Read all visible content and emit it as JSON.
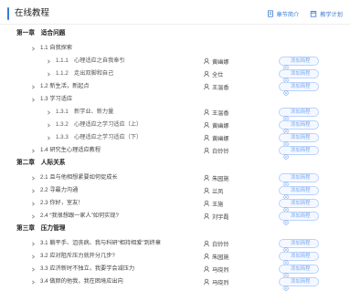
{
  "header": {
    "title": "在线教程",
    "links": [
      {
        "label": "章节简介",
        "icon": "document-icon"
      },
      {
        "label": "教学计划",
        "icon": "calendar-icon"
      }
    ]
  },
  "rows": [
    {
      "kind": "chapter",
      "label": "第一章　适合问题"
    },
    {
      "kind": "section",
      "label": "1.1 自我探索",
      "user": "",
      "button": ""
    },
    {
      "kind": "sub",
      "label": "1.1.1　心理适应之自我奉引",
      "user": "黄幽娜",
      "button": "添加简程"
    },
    {
      "kind": "sub",
      "label": "1.1.2　走出双脚和自己",
      "user": "全仕",
      "button": "添加简程"
    },
    {
      "kind": "section",
      "label": "1.2 新生活，新起点",
      "user": "王温香",
      "button": "添加简程"
    },
    {
      "kind": "section",
      "label": "1.3 学习适应",
      "user": "",
      "button": ""
    },
    {
      "kind": "sub",
      "label": "1.3.1　新学业、新力量",
      "user": "王温香",
      "button": "添加简程"
    },
    {
      "kind": "sub",
      "label": "1.3.2　心理适应之学习适应（上）",
      "user": "黄幽娜",
      "button": "添加简程"
    },
    {
      "kind": "sub",
      "label": "1.3.3　心理适应之学习适应（下）",
      "user": "黄幽娜",
      "button": "添加简程"
    },
    {
      "kind": "section",
      "label": "1.4 研究生心理适应教程",
      "user": "白铃铃",
      "button": "添加简程"
    },
    {
      "kind": "chapter",
      "label": "第二章　人际关系"
    },
    {
      "kind": "section",
      "label": "2.1 且与他相想紧要如何促成长",
      "user": "朱园施",
      "button": "添加简程"
    },
    {
      "kind": "section",
      "label": "2.2 寻最力沟通",
      "user": "兰凤",
      "button": "添加简程"
    },
    {
      "kind": "section",
      "label": "2.3 你好，室友！",
      "user": "王施",
      "button": "添加简程"
    },
    {
      "kind": "section",
      "label": "2.4 “我很想跟一家人”如何实现?",
      "user": "刘宇磊",
      "button": "添加简程"
    },
    {
      "kind": "chapter",
      "label": "第三章　压力管理"
    },
    {
      "kind": "section",
      "label": "3.1 躺平手、沮丧病、我与科研“相持相爱”到终章",
      "user": "白铃铃",
      "button": "添加简程"
    },
    {
      "kind": "section",
      "label": "3.2 应对阻斥压力就开分几步?",
      "user": "朱园施",
      "button": "添加简程"
    },
    {
      "kind": "section",
      "label": "3.3 应济新时不独立，我要学会减压力",
      "user": "马晓烈",
      "button": "添加简程"
    },
    {
      "kind": "section",
      "label": "3.4 做颜的他我，我在困境应出向",
      "user": "马晓烈",
      "button": "添加简程"
    }
  ],
  "colors": {
    "accent": "#3a7bd5",
    "button_border": "#b9d2ff"
  }
}
